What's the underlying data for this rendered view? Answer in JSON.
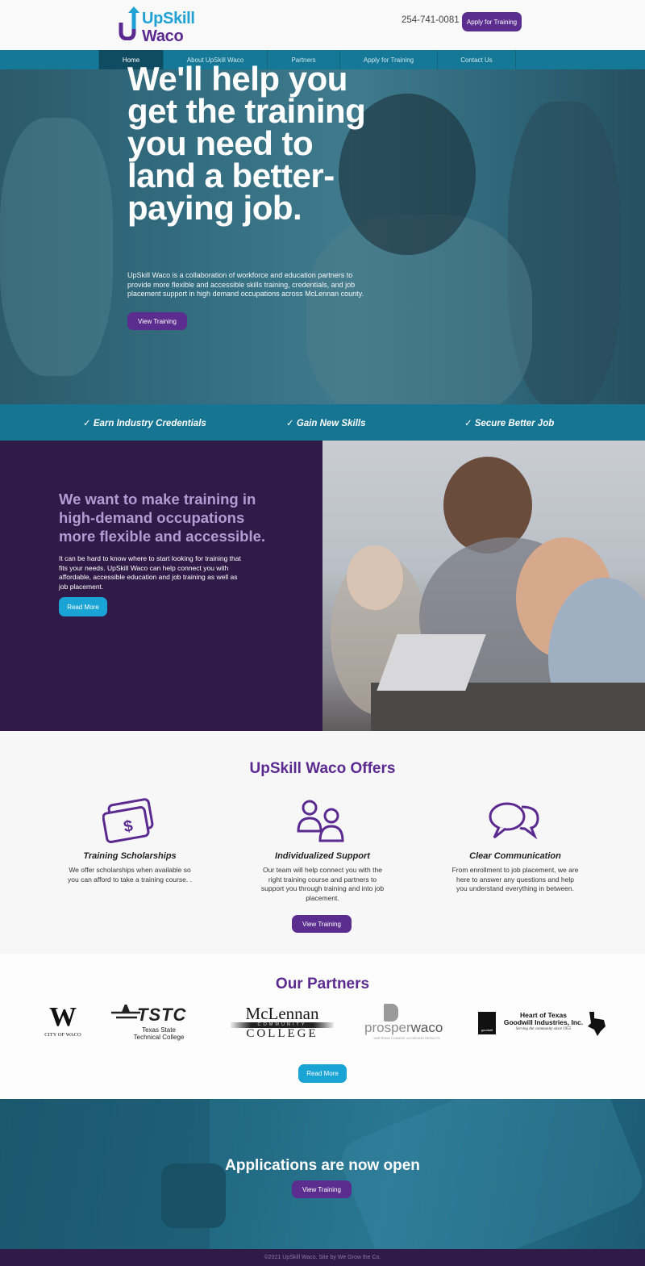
{
  "header": {
    "logo": {
      "line1": "UpSkill",
      "line2": "Waco",
      "icon": "up-arrow-u-icon"
    },
    "phone": "254-741-0081",
    "apply_button": "Apply for Training"
  },
  "nav": {
    "items": [
      {
        "label": "Home",
        "active": true
      },
      {
        "label": "About UpSkill Waco",
        "active": false
      },
      {
        "label": "Partners",
        "active": false
      },
      {
        "label": "Apply for Training",
        "active": false
      },
      {
        "label": "Contact Us",
        "active": false
      }
    ]
  },
  "hero": {
    "title": "We'll help you get the training you need to land a better-paying job.",
    "text": "UpSkill Waco is a collaboration of workforce and education partners to provide more flexible and accessible skills training, credentials, and job placement support in high demand occupations across McLennan county.",
    "button": "View Training"
  },
  "benefits": [
    "✓ Earn Industry Credentials",
    "✓ Gain New Skills",
    "✓ Secure Better Job"
  ],
  "about": {
    "title": "We want to make training in high-demand occupations more flexible and accessible.",
    "text": "It can be hard to know where to start looking for training that fits your needs. UpSkill Waco can help connect you with affordable, accessible education and job training as well as job placement.",
    "button": "Read More"
  },
  "offers": {
    "title": "UpSkill Waco Offers",
    "items": [
      {
        "icon": "money-bills-icon",
        "heading": "Training Scholarships",
        "text": "We offer scholarships when available so you can afford to take a training course. ."
      },
      {
        "icon": "people-icon",
        "heading": "Individualized Support",
        "text": "Our team will help connect you with the right training course and partners to support you through training and into job placement."
      },
      {
        "icon": "chat-bubbles-icon",
        "heading": "Clear Communication",
        "text": "From enrollment to job placement, we are here to answer any questions and help you understand everything in between."
      }
    ],
    "button": "View Training"
  },
  "partners": {
    "title": "Our Partners",
    "logos": {
      "waco": {
        "mark": "W",
        "caption": "CITY OF WACO"
      },
      "tstc": {
        "mark": "TSTC",
        "caption1": "Texas State",
        "caption2": "Technical College"
      },
      "mclennan": {
        "line1": "McLennan",
        "line2": "COMMUNITY",
        "line3": "COLLEGE"
      },
      "prosper": {
        "word1": "prosper",
        "word2": "waco",
        "tagline": "INSPIRING CHANGE. ACHIEVING RESULTS."
      },
      "goodwill": {
        "line1": "Heart of Texas",
        "line2": "Goodwill Industries, Inc.",
        "tagline": "Serving the community since 1955",
        "badge": "goodwill"
      }
    },
    "button": "Read More"
  },
  "cta": {
    "title": "Applications are now open",
    "button": "View Training"
  },
  "footer": {
    "text": "©2021 UpSkill Waco. Site by We Grow the Co."
  },
  "colors": {
    "purple": "#5b2d8e",
    "teal": "#157897",
    "dark_purple": "#2f1a48",
    "light_blue": "#1aa4d6"
  }
}
